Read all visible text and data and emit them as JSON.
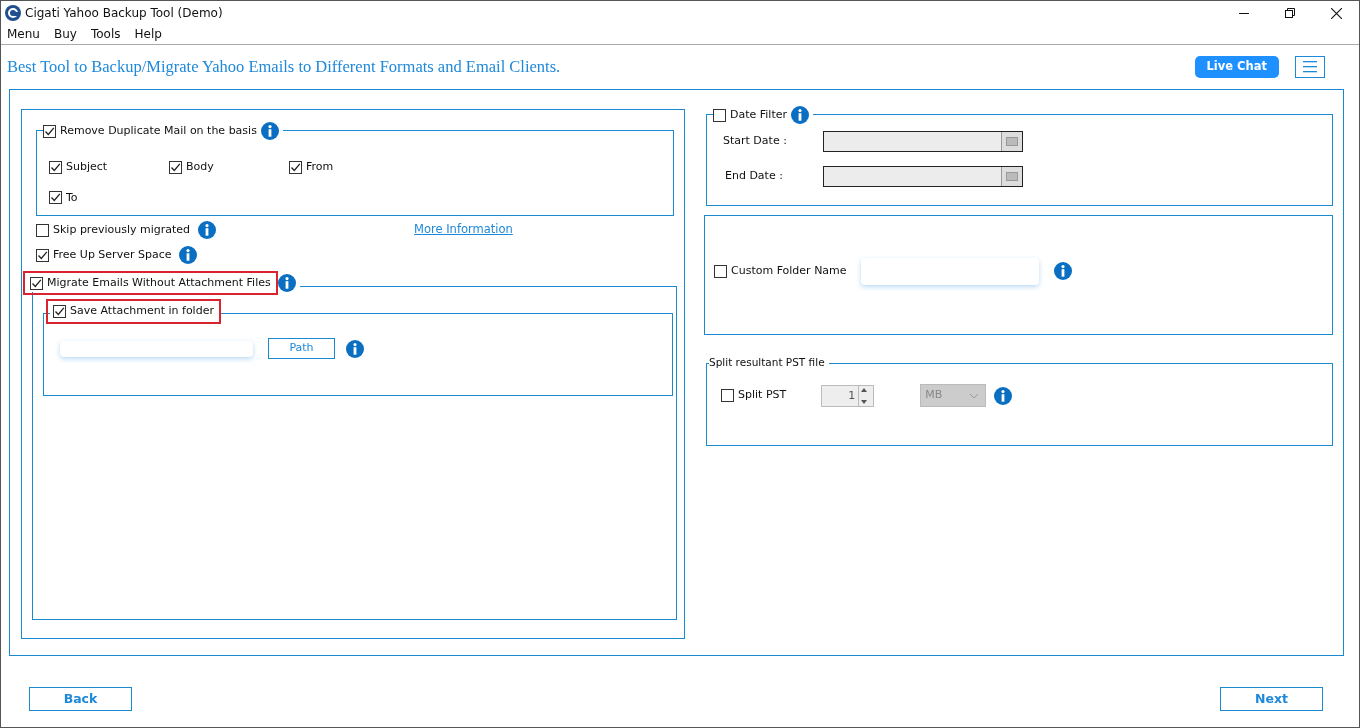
{
  "window": {
    "title": "Cigati Yahoo Backup Tool (Demo)"
  },
  "menu": [
    "Menu",
    "Buy",
    "Tools",
    "Help"
  ],
  "header": {
    "title": "Best Tool to Backup/Migrate Yahoo Emails to Different Formats and Email Clients.",
    "live_chat": "Live Chat"
  },
  "left": {
    "remove_duplicate": {
      "label": "Remove Duplicate Mail on the basis",
      "checked": true,
      "options": [
        {
          "label": "Subject",
          "checked": true
        },
        {
          "label": "Body",
          "checked": true
        },
        {
          "label": "From",
          "checked": true
        },
        {
          "label": "To",
          "checked": true
        }
      ]
    },
    "skip_previously": {
      "label": "Skip previously migrated",
      "checked": false
    },
    "more_information": "More Information",
    "free_up": {
      "label": "Free Up Server Space",
      "checked": true
    },
    "without_attachment": {
      "label": "Migrate Emails Without Attachment Files",
      "checked": true,
      "highlighted": true
    },
    "save_attachment": {
      "label": "Save Attachment in folder",
      "checked": true,
      "highlighted": true
    },
    "path_button": "Path"
  },
  "right": {
    "date_filter": {
      "label": "Date Filter",
      "checked": false,
      "start_label": "Start Date :",
      "end_label": "End Date :"
    },
    "custom_folder": {
      "label": "Custom Folder Name",
      "checked": false
    },
    "split": {
      "legend": "Split resultant PST file",
      "label": "Split PST",
      "checked": false,
      "count": "1",
      "unit": "MB"
    }
  },
  "footer": {
    "back": "Back",
    "next": "Next"
  }
}
